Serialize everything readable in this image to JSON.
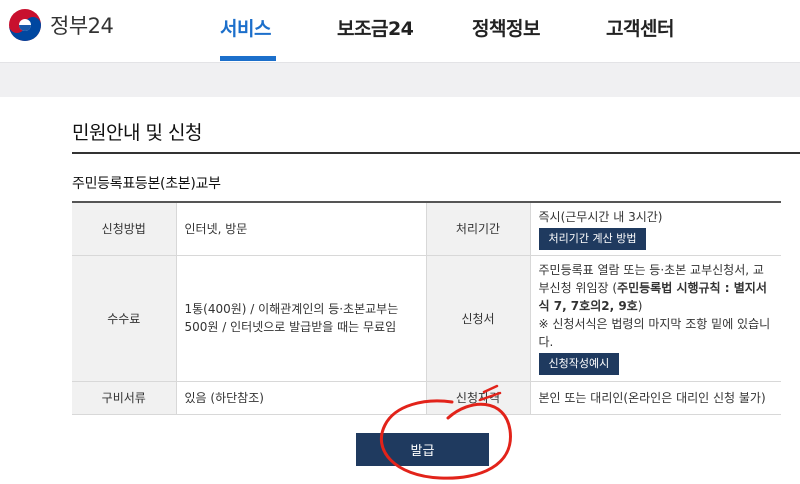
{
  "header": {
    "logo_text": "정부24",
    "nav": [
      "서비스",
      "보조금24",
      "정책정보",
      "고객센터"
    ],
    "active_nav": "서비스"
  },
  "main": {
    "title": "민원안내 및 신청",
    "subtitle": "주민등록표등본(초본)교부",
    "rows": [
      {
        "label1": "신청방법",
        "value1": "인터넷, 방문",
        "label2": "처리기간",
        "value2_text": "즉시(근무시간 내 3시간)",
        "value2_button": "처리기간 계산 방법"
      },
      {
        "label1": "수수료",
        "value1": "1통(400원) / 이해관계인의 등·초본교부는 500원 / 인터넷으로 발급받을 때는 무료임",
        "label2": "신청서",
        "value2_line1": "주민등록표 열람 또는 등·초본 교부신청서, 교부신청 위임장 (",
        "value2_bold": "주민등록법 시행규칙 : 별지서식 7, 7호의2, 9호",
        "value2_line1_end": ")",
        "value2_note": "※ 신청서식은 법령의 마지막 조항 밑에 있습니다.",
        "value2_button": "신청작성예시"
      },
      {
        "label1": "구비서류",
        "value1": "있음 (하단참조)",
        "label2": "신청자격",
        "value2_text": "본인 또는 대리인(온라인은 대리인 신청 불가)"
      }
    ],
    "issue_button": "발급"
  },
  "colors": {
    "accent": "#1c6fcb",
    "navy_button": "#1f3a5f",
    "annotation_red": "#e2231a"
  }
}
